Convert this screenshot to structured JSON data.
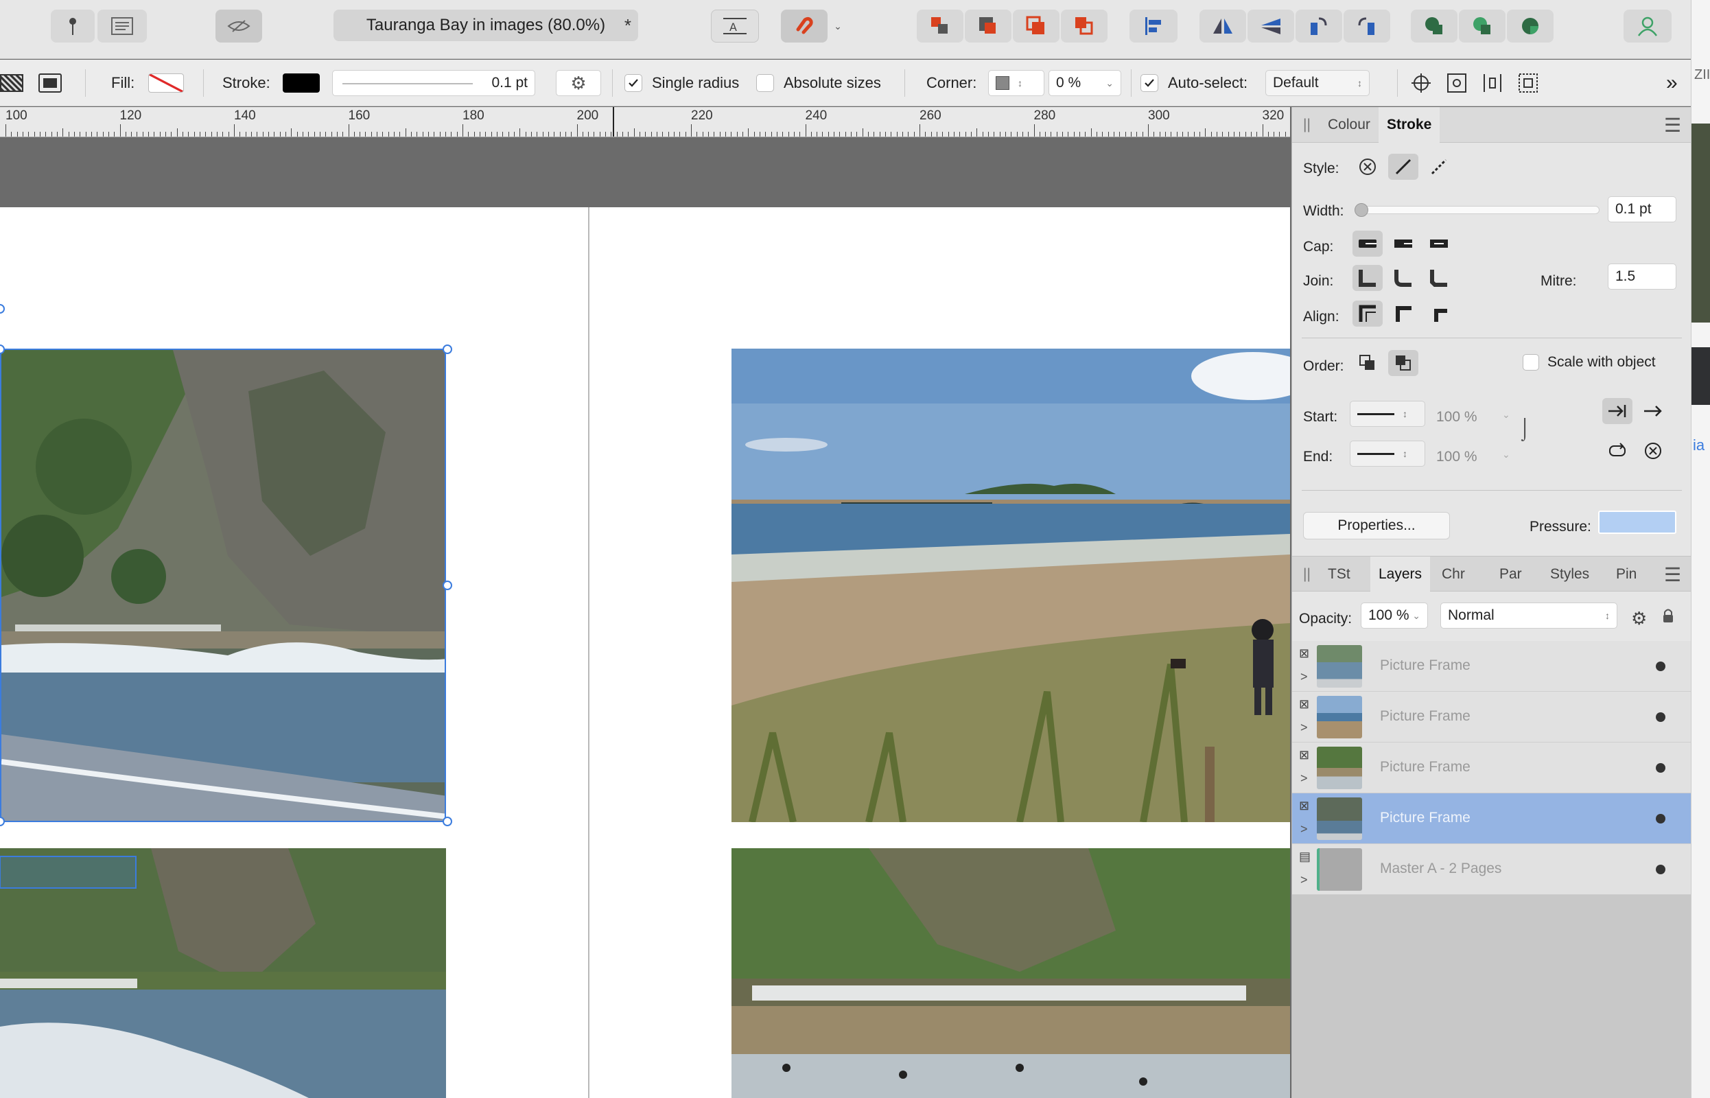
{
  "document": {
    "title": "Tauranga Bay in images (80.0%)",
    "modified_marker": "*"
  },
  "toolbar": {
    "tools": [
      "pin-tool",
      "text-frame-tool",
      "preview-mode",
      "text-wrap",
      "snapping",
      "arrange-back",
      "arrange-backward",
      "arrange-forward",
      "arrange-front",
      "align",
      "flip-horizontal",
      "flip-vertical",
      "rotate-left",
      "rotate-right",
      "add",
      "subtract",
      "intersect",
      "user-account"
    ]
  },
  "context": {
    "fill_label": "Fill:",
    "stroke_label": "Stroke:",
    "stroke_width": "0.1 pt",
    "single_radius_label": "Single radius",
    "single_radius_checked": true,
    "absolute_sizes_label": "Absolute sizes",
    "absolute_sizes_checked": false,
    "corner_label": "Corner:",
    "corner_value": "0 %",
    "auto_select_label": "Auto-select:",
    "auto_select_checked": true,
    "auto_select_value": "Default",
    "more": "»"
  },
  "ruler": {
    "labels": [
      "100",
      "120",
      "140",
      "160",
      "180",
      "200",
      "220",
      "240",
      "260",
      "280",
      "300",
      "320"
    ]
  },
  "stroke_panel": {
    "tabs": [
      "Colour",
      "Stroke"
    ],
    "active_tab": "Stroke",
    "style_label": "Style:",
    "width_label": "Width:",
    "width_value": "0.1 pt",
    "cap_label": "Cap:",
    "join_label": "Join:",
    "mitre_label": "Mitre:",
    "mitre_value": "1.5",
    "align_label": "Align:",
    "order_label": "Order:",
    "scale_label": "Scale with object",
    "start_label": "Start:",
    "start_pct": "100 %",
    "end_label": "End:",
    "end_pct": "100 %",
    "properties_label": "Properties...",
    "pressure_label": "Pressure:"
  },
  "layers_panel": {
    "tabs": [
      "TSt",
      "Layers",
      "Chr",
      "Par",
      "Styles",
      "Pin"
    ],
    "active_tab": "Layers",
    "opacity_label": "Opacity:",
    "opacity_value": "100 %",
    "blend_mode": "Normal",
    "layers": [
      {
        "name": "Picture Frame",
        "selected": false
      },
      {
        "name": "Picture Frame",
        "selected": false
      },
      {
        "name": "Picture Frame",
        "selected": false
      },
      {
        "name": "Picture Frame",
        "selected": true
      },
      {
        "name": "Master A - 2 Pages",
        "selected": false
      }
    ]
  },
  "colors": {
    "accent": "#3b7cde",
    "selected_row": "#95b4e3",
    "toolbar_orange": "#d9411e"
  },
  "edge_strip": {
    "top_text": "ZII",
    "mid_text": "ia"
  }
}
